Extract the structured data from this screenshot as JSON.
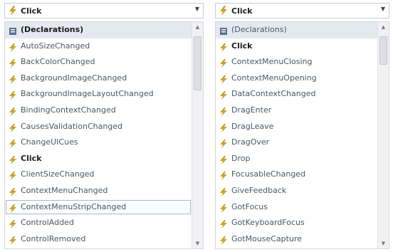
{
  "left": {
    "combo": {
      "text": "Click"
    },
    "items": [
      {
        "label": "(Declarations)",
        "bold": true,
        "highlight": true,
        "icon": "declarations-icon"
      },
      {
        "label": "AutoSizeChanged",
        "icon": "event-icon"
      },
      {
        "label": "BackColorChanged",
        "icon": "event-icon"
      },
      {
        "label": "BackgroundImageChanged",
        "icon": "event-icon"
      },
      {
        "label": "BackgroundImageLayoutChanged",
        "icon": "event-icon"
      },
      {
        "label": "BindingContextChanged",
        "icon": "event-icon"
      },
      {
        "label": "CausesValidationChanged",
        "icon": "event-icon"
      },
      {
        "label": "ChangeUICues",
        "icon": "event-icon"
      },
      {
        "label": "Click",
        "bold": true,
        "icon": "event-icon"
      },
      {
        "label": "ClientSizeChanged",
        "icon": "event-icon"
      },
      {
        "label": "ContextMenuChanged",
        "icon": "event-icon"
      },
      {
        "label": "ContextMenuStripChanged",
        "outlined": true,
        "icon": "event-icon"
      },
      {
        "label": "ControlAdded",
        "icon": "event-icon"
      },
      {
        "label": "ControlRemoved",
        "icon": "event-icon"
      }
    ]
  },
  "right": {
    "combo": {
      "text": "Click"
    },
    "items": [
      {
        "label": "(Declarations)",
        "highlight": true,
        "icon": "declarations-icon"
      },
      {
        "label": "Click",
        "bold": true,
        "icon": "event-icon"
      },
      {
        "label": "ContextMenuClosing",
        "icon": "event-icon"
      },
      {
        "label": "ContextMenuOpening",
        "icon": "event-icon"
      },
      {
        "label": "DataContextChanged",
        "icon": "event-icon"
      },
      {
        "label": "DragEnter",
        "icon": "event-icon"
      },
      {
        "label": "DragLeave",
        "icon": "event-icon"
      },
      {
        "label": "DragOver",
        "icon": "event-icon"
      },
      {
        "label": "Drop",
        "icon": "event-icon"
      },
      {
        "label": "FocusableChanged",
        "icon": "event-icon"
      },
      {
        "label": "GiveFeedback",
        "icon": "event-icon"
      },
      {
        "label": "GotFocus",
        "icon": "event-icon"
      },
      {
        "label": "GotKeyboardFocus",
        "icon": "event-icon"
      },
      {
        "label": "GotMouseCapture",
        "icon": "event-icon"
      }
    ]
  },
  "colors": {
    "event_icon": "#c9a227",
    "declarations_icon": "#5a6e8a"
  }
}
